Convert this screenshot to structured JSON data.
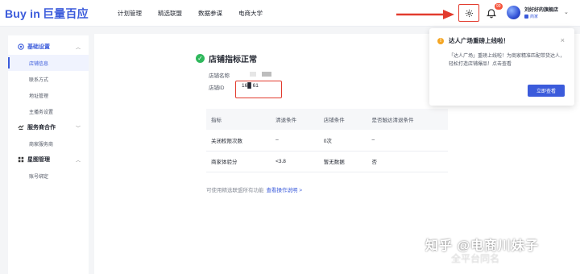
{
  "brand": {
    "latin": "Buy in",
    "cn": "巨量百应"
  },
  "topnav": [
    "计划管理",
    "精选联盟",
    "数据参谋",
    "电商大学"
  ],
  "notifications": {
    "count": "99"
  },
  "account": {
    "name": "刘好好的旗舰店",
    "tag": "商家"
  },
  "sidebar": {
    "sections": [
      {
        "label": "基础设置",
        "items": [
          "店铺信息",
          "联系方式",
          "地址管理",
          "主播务设置"
        ]
      },
      {
        "label": "服务商合作",
        "items": [
          "商家服务商"
        ]
      },
      {
        "label": "星图管理",
        "items": [
          "账号绑定"
        ]
      }
    ]
  },
  "main": {
    "status": "店铺指标正常",
    "shop_name_label": "店铺名称",
    "shop_id_label": "店铺ID",
    "shop_id_value": "16█ 61",
    "table": {
      "headers": [
        "指标",
        "清退条件",
        "店铺条件",
        "是否触达清退条件"
      ],
      "rows": [
        [
          "关闭权限次数",
          "–",
          "0次",
          "–"
        ],
        [
          "商家体验分",
          "<3.8",
          "暂无数据",
          "否"
        ]
      ]
    },
    "note": "可使用精选联盟所有功能",
    "note_link": "查看操作说明 >"
  },
  "popup": {
    "title": "达人广场重磅上线啦！",
    "body": "「达人广场」重磅上线啦！为商家精准匹配带货达人，轻松打造店铺爆品！点击查看",
    "button": "立即查看"
  },
  "watermark": {
    "line1": "知乎 @电商川妹子",
    "line2": "全平台同名"
  },
  "colors": {
    "accent": "#3b5bdb",
    "annotation_red": "#e23b2e",
    "ok_green": "#2fb85c"
  }
}
